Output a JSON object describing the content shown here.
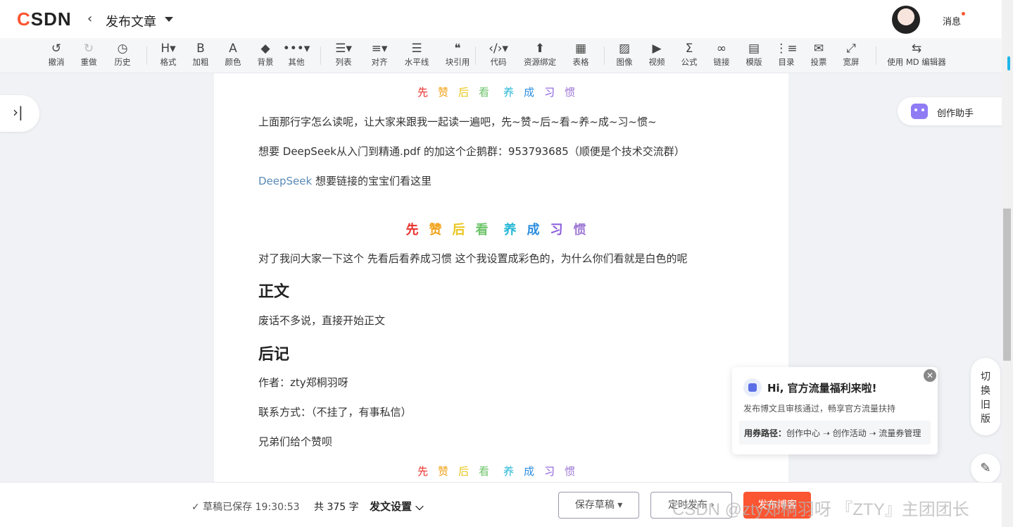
{
  "header": {
    "logo": "CSDN",
    "back_icon": "chevron-left-icon",
    "title": "发布文章",
    "messages": "消息"
  },
  "toolbar": [
    {
      "icon": "undo-icon",
      "glyph": "↺",
      "label": "撤消",
      "disabled": false
    },
    {
      "icon": "redo-icon",
      "glyph": "↻",
      "label": "重做",
      "disabled": true
    },
    {
      "icon": "history-icon",
      "glyph": "◷",
      "label": "历史",
      "disabled": false
    },
    {
      "icon": "heading-icon",
      "glyph": "H▾",
      "label": "格式",
      "disabled": false
    },
    {
      "icon": "bold-icon",
      "glyph": "B",
      "label": "加粗",
      "disabled": false
    },
    {
      "icon": "font-color-icon",
      "glyph": "A",
      "label": "颜色",
      "disabled": false
    },
    {
      "icon": "paint-bucket-icon",
      "glyph": "◆",
      "label": "背景",
      "disabled": false
    },
    {
      "icon": "more-icon",
      "glyph": "•••▾",
      "label": "其他",
      "disabled": false
    },
    {
      "icon": "list-icon",
      "glyph": "☰▾",
      "label": "列表",
      "disabled": false
    },
    {
      "icon": "align-icon",
      "glyph": "≡▾",
      "label": "对齐",
      "disabled": false
    },
    {
      "icon": "horizontal-rule-icon",
      "glyph": "☰",
      "label": "水平线",
      "disabled": false
    },
    {
      "icon": "quote-icon",
      "glyph": "❝",
      "label": "块引用",
      "disabled": false
    },
    {
      "icon": "code-icon",
      "glyph": "‹/›▾",
      "label": "代码",
      "disabled": false
    },
    {
      "icon": "resource-bind-icon",
      "glyph": "⬆",
      "label": "资源绑定",
      "disabled": false
    },
    {
      "icon": "table-icon",
      "glyph": "▦",
      "label": "表格",
      "disabled": false
    },
    {
      "icon": "image-icon",
      "glyph": "▨",
      "label": "图像",
      "disabled": false
    },
    {
      "icon": "video-icon",
      "glyph": "▶",
      "label": "视频",
      "disabled": false
    },
    {
      "icon": "formula-icon",
      "glyph": "Σ",
      "label": "公式",
      "disabled": false
    },
    {
      "icon": "link-icon",
      "glyph": "∞",
      "label": "链接",
      "disabled": false
    },
    {
      "icon": "template-icon",
      "glyph": "▤",
      "label": "模版",
      "disabled": false
    },
    {
      "icon": "toc-icon",
      "glyph": "⋮≡",
      "label": "目录",
      "disabled": false
    },
    {
      "icon": "vote-icon",
      "glyph": "✉",
      "label": "投票",
      "disabled": false
    },
    {
      "icon": "wide-screen-icon",
      "glyph": "⤢",
      "label": "宽屏",
      "disabled": false
    },
    {
      "icon": "switch-md-icon",
      "glyph": "⇆",
      "label": "使用 MD 编辑器",
      "disabled": false
    }
  ],
  "article": {
    "rainbow_small": [
      "先",
      "赞",
      "后",
      "看",
      "养",
      "成",
      "习",
      "惯"
    ],
    "rainbow_colors": [
      "#e8322c",
      "#f2a31a",
      "#e8c61c",
      "#6dc46a",
      "#25b7d6",
      "#2e8ee0",
      "#8a5cdb",
      "#a07ad6"
    ],
    "line1": "上面那行字怎么读呢，让大家来跟我一起读一遍吧，先~赞~后~看~养~成~习~惯~",
    "line2": "想要 DeepSeek从入门到精通.pdf 的加这个企鹅群：953793685（顺便是个技术交流群）",
    "link_text": "DeepSeek",
    "line3_rest": " 想要链接的宝宝们看这里",
    "rainbow_big": [
      "先",
      "赞",
      "后",
      "看",
      "养",
      "成",
      "习",
      "惯"
    ],
    "line4": "对了我问大家一下这个 先看后看养成习惯 这个我设置成彩色的，为什么你们看就是白色的呢",
    "heading1": "正文",
    "line5": "废话不多说，直接开始正文",
    "heading2": "后记",
    "line6": "作者：zty郑桐羽呀",
    "line7": "联系方式：（不挂了，有事私信）",
    "line8": "兄弟们给个赞呗"
  },
  "assistant": {
    "label": "创作助手",
    "icon": "robot-icon"
  },
  "switch_old": [
    "切",
    "换",
    "旧",
    "版"
  ],
  "feedback_icon": "feedback-icon",
  "promo": {
    "title": "Hi, 官方流量福利来啦!",
    "subtitle": "发布博文且审核通过，畅享官方流量扶持",
    "path_label": "用券路径：",
    "path": "创作中心 ➝ 创作活动 ➝ 流量券管理"
  },
  "bottom": {
    "saved": "✓ 草稿已保存 19:30:53",
    "count": "共 375 字",
    "settings": "发文设置",
    "save_draft": "保存草稿 ▾",
    "schedule": "定时发布 ›",
    "publish": "发布博客"
  },
  "watermark": "CSDN @zty郑桐羽呀    『ZTY』主团团长"
}
